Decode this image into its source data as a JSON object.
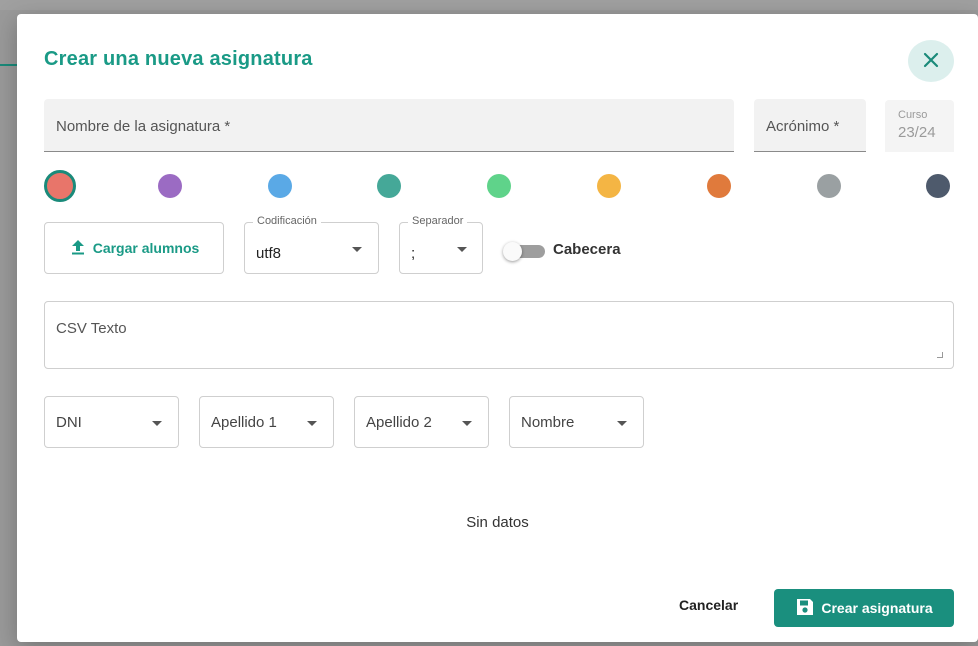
{
  "dialog": {
    "title": "Crear una nueva asignatura",
    "close_icon": "close-icon"
  },
  "fields": {
    "name_label": "Nombre de la asignatura *",
    "acronym_label": "Acrónimo *",
    "course_label": "Curso",
    "course_value": "23/24"
  },
  "colors": {
    "accent": "#1a9a86",
    "palette": [
      "#e8756a",
      "#9b6bc3",
      "#5aa9e6",
      "#45a898",
      "#5fd38a",
      "#f4b544",
      "#e07a3c",
      "#9aa0a2",
      "#4e5a6c"
    ],
    "selected_index": 0
  },
  "import": {
    "upload_label": "Cargar alumnos",
    "upload_icon": "upload-icon",
    "encoding_legend": "Codificación",
    "encoding_value": "utf8",
    "separator_legend": "Separador",
    "separator_value": ";",
    "header_toggle_label": "Cabecera",
    "header_toggle_on": false,
    "csv_placeholder": "CSV Texto"
  },
  "columns": [
    "DNI",
    "Apellido 1",
    "Apellido 2",
    "Nombre"
  ],
  "table": {
    "empty_text": "Sin datos"
  },
  "actions": {
    "cancel_label": "Cancelar",
    "create_label": "Crear asignatura",
    "create_icon": "save-icon"
  }
}
